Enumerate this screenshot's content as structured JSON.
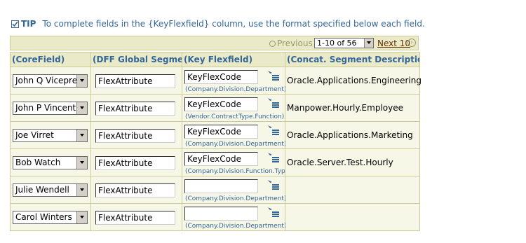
{
  "tip": {
    "label": "TIP",
    "text": "To complete fields in the {KeyFlexfield} column, use the format specified below each field.",
    "icon": "checkbox-tip-icon"
  },
  "navigation": {
    "previous_label": "Previous",
    "range_value": "1-10 of 56",
    "next_label": "Next 10"
  },
  "table": {
    "headers": [
      "(CoreField)",
      "(DFF Global Segment)",
      "(Key Flexfield)",
      "(Concat. Segment Descriptions)"
    ],
    "rows": [
      {
        "core": "John Q Viceprez",
        "dff": "FlexAttribute",
        "kff": "KeyFlexCode",
        "structure": "(Company.Division.Department)",
        "desc": "Oracle.Applications.Engineering"
      },
      {
        "core": "John P Vincent",
        "dff": "FlexAttribute",
        "kff": "KeyFlexCode",
        "structure": "(Vendor.ContractType.Function)",
        "desc": "Manpower.Hourly.Employee"
      },
      {
        "core": "Joe Virret",
        "dff": "FlexAttribute",
        "kff": "KeyFlexCode",
        "structure": "(Company.Division.Department)",
        "desc": "Oracle.Applications.Marketing"
      },
      {
        "core": "Bob Watch",
        "dff": "FlexAttribute",
        "kff": "KeyFlexCode",
        "structure": "(Company.Division.Function.Type)",
        "desc": "Oracle.Server.Test.Hourly"
      },
      {
        "core": "Julie Wendell",
        "dff": "FlexAttribute",
        "kff": "",
        "structure": "(Company.Division.Department)",
        "desc": ""
      },
      {
        "core": "Carol Winters",
        "dff": "FlexAttribute",
        "kff": "",
        "structure": "(Company.Division.Department)",
        "desc": ""
      }
    ]
  },
  "colors": {
    "header_bg": "#eaeac9",
    "header_text": "#336699",
    "cell_bg": "#f7f7e7",
    "border": "#cccc99",
    "link": "#663300"
  }
}
